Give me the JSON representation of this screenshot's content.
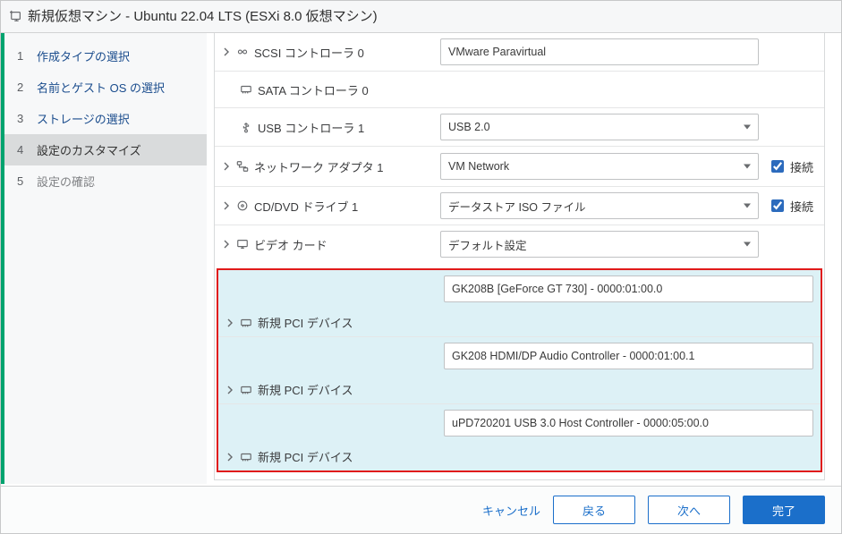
{
  "dialog": {
    "title": "新規仮想マシン - Ubuntu 22.04 LTS (ESXi 8.0 仮想マシン)"
  },
  "steps": [
    {
      "num": "1",
      "label": "作成タイプの選択"
    },
    {
      "num": "2",
      "label": "名前とゲスト OS の選択"
    },
    {
      "num": "3",
      "label": "ストレージの選択"
    },
    {
      "num": "4",
      "label": "設定のカスタマイズ"
    },
    {
      "num": "5",
      "label": "設定の確認"
    }
  ],
  "rows": {
    "scsi": {
      "label": "SCSI コントローラ 0",
      "value": "VMware Paravirtual"
    },
    "sata": {
      "label": "SATA コントローラ 0"
    },
    "usb": {
      "label": "USB コントローラ 1",
      "value": "USB 2.0"
    },
    "net": {
      "label": "ネットワーク アダプタ 1",
      "value": "VM Network",
      "connect": "接続"
    },
    "cd": {
      "label": "CD/DVD ドライブ 1",
      "value": "データストア ISO ファイル",
      "connect": "接続"
    },
    "video": {
      "label": "ビデオ カード",
      "value": "デフォルト設定"
    },
    "pci1": {
      "label": "新規 PCI デバイス",
      "value": "GK208B [GeForce GT 730] - 0000:01:00.0"
    },
    "pci2": {
      "label": "新規 PCI デバイス",
      "value": "GK208 HDMI/DP Audio Controller - 0000:01:00.1"
    },
    "pci3": {
      "label": "新規 PCI デバイス",
      "value": "uPD720201 USB 3.0 Host Controller - 0000:05:00.0"
    }
  },
  "footer": {
    "cancel": "キャンセル",
    "back": "戻る",
    "next": "次へ",
    "finish": "完了"
  }
}
